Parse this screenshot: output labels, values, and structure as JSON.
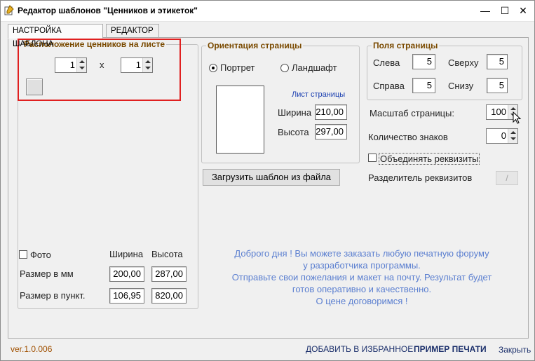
{
  "window": {
    "title": "Редактор шаблонов \"Ценников и этикеток\"",
    "minimize": "—",
    "maximize": "☐",
    "close": "✕"
  },
  "tabs": [
    {
      "label": "НАСТРОЙКА ШАБЛОНА"
    },
    {
      "label": "РЕДАКТОР"
    }
  ],
  "placement": {
    "title": "Расположение ценников на листе",
    "cols": "1",
    "x_label": "x",
    "rows": "1"
  },
  "orientation": {
    "title": "Ориентация страницы",
    "portrait": "Портрет",
    "landscape": "Ландшафт",
    "selected": "portrait",
    "sheet_title": "Лист страницы",
    "width_label": "Ширина",
    "width": "210,00",
    "height_label": "Высота",
    "height": "297,00"
  },
  "margins": {
    "title": "Поля страницы",
    "left_label": "Слева",
    "left": "5",
    "top_label": "Сверху",
    "top": "5",
    "right_label": "Справа",
    "right": "5",
    "bottom_label": "Снизу",
    "bottom": "5"
  },
  "settings": {
    "scale_label": "Масштаб страницы:",
    "scale": "100",
    "digits_label": "Количество знаков",
    "digits": "0",
    "combine_label": "Объединять реквизиты",
    "separator_label": "Разделитель реквизитов",
    "separator": "/"
  },
  "load_button": "Загрузить шаблон из файла",
  "photo": {
    "label": "Фото",
    "width_header": "Ширина",
    "height_header": "Высота",
    "mm_label": "Размер в мм",
    "mm_width": "200,00",
    "mm_height": "287,00",
    "pt_label": "Размер в пункт.",
    "pt_width": "106,95",
    "pt_height": "820,00"
  },
  "info": {
    "line1": "Доброго дня ! Вы можете  заказать любую печатную форуму",
    "line2": "у разработчика программы.",
    "line3": "Отправьте свои пожелания и макет на почту. Результат будет",
    "line4": "готов оперативно и качественно.",
    "line5": "О цене договоримся !"
  },
  "footer": {
    "version": "ver.1.0.006",
    "favorites": "ДОБАВИТЬ В ИЗБРАННОЕ",
    "print_example": "ПРИМЕР ПЕЧАТИ",
    "close": "Закрыть"
  },
  "colors": {
    "highlight": "#e02020",
    "group_title": "#7a4a00",
    "info_text": "#5b7fd0",
    "version": "#a05000"
  }
}
